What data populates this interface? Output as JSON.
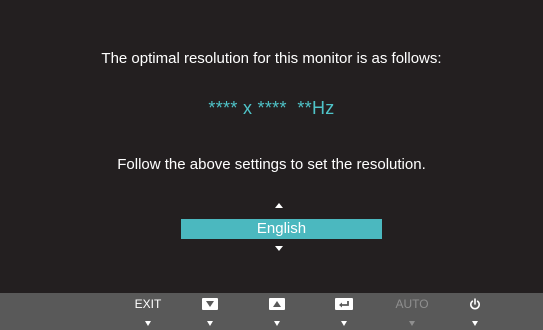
{
  "dialog": {
    "message_line1": "The optimal resolution for this monitor is as follows:",
    "resolution_value": "**** x ****  **Hz",
    "message_line2": "Follow the above settings to set the resolution.",
    "language_selected": "English"
  },
  "controls": [
    {
      "label": "EXIT",
      "icon": "text-label"
    },
    {
      "label": "",
      "icon": "down-arrow-icon"
    },
    {
      "label": "",
      "icon": "up-arrow-icon"
    },
    {
      "label": "",
      "icon": "enter-icon"
    },
    {
      "label": "AUTO",
      "icon": "text-label",
      "state": "disabled"
    },
    {
      "label": "",
      "icon": "power-icon"
    }
  ],
  "colors": {
    "background": "#231f20",
    "accent": "#4bb8bf",
    "resolution_text": "#4fc3c8",
    "control_bar": "#595959",
    "disabled_text": "#8f8f8f"
  }
}
